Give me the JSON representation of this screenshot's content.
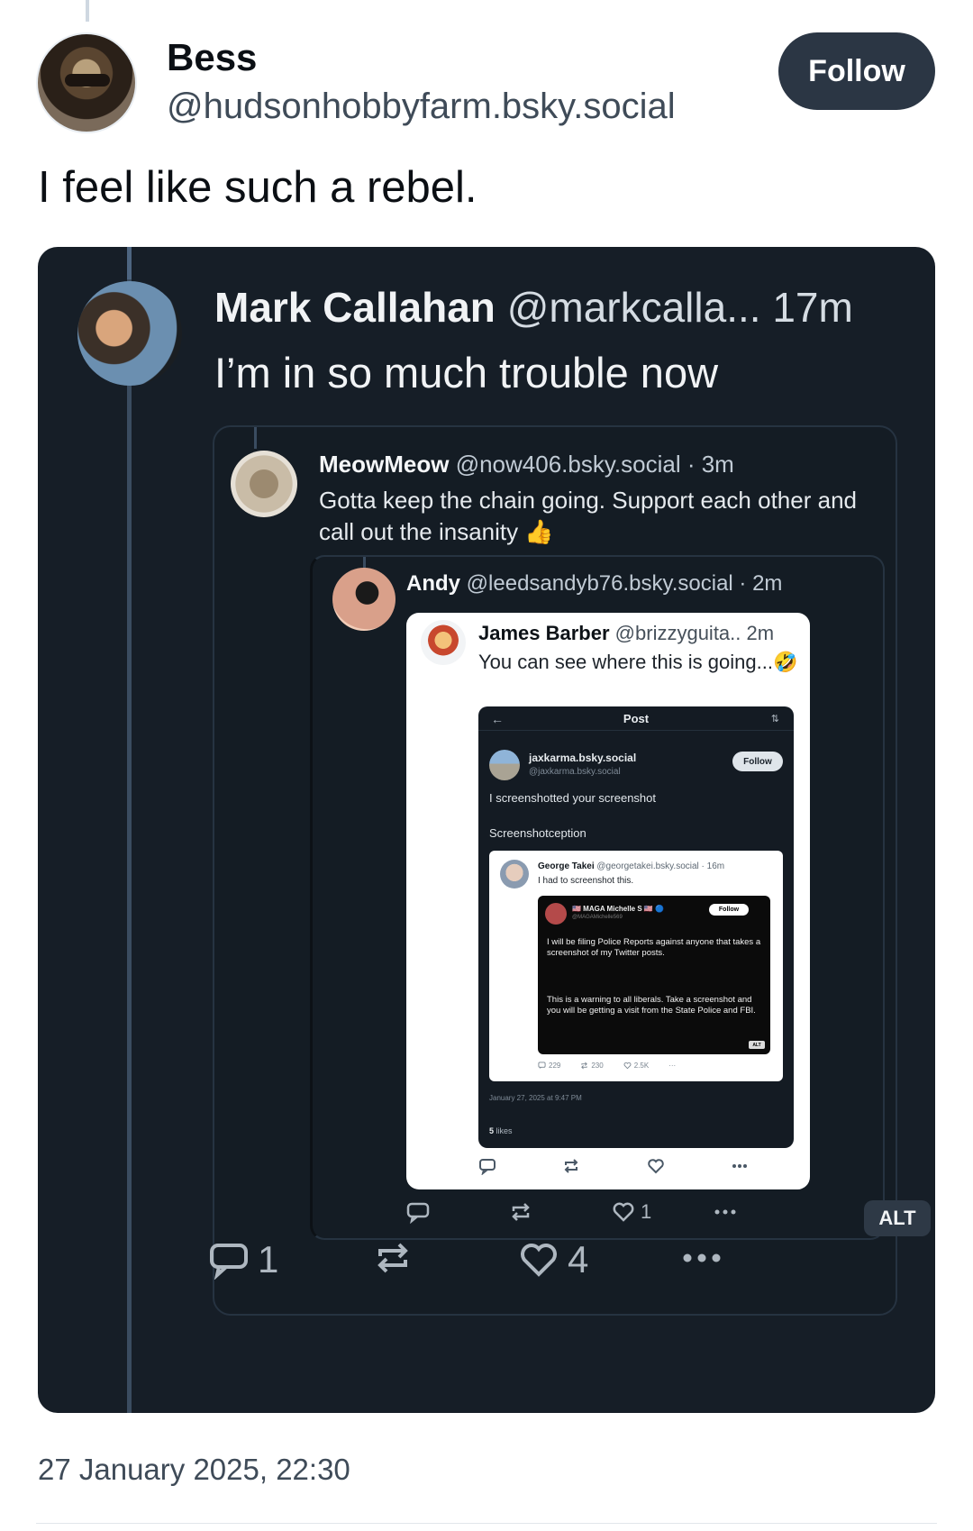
{
  "post": {
    "display_name": "Bess",
    "handle": "@hudsonhobbyfarm.bsky.social",
    "follow_label": "Follow",
    "text": "I feel like such a rebel.",
    "timestamp": "27 January 2025, 22:30"
  },
  "embed": {
    "author_name": "Mark Callahan",
    "author_meta": "@markcalla... 17m",
    "text": "I’m in so much trouble now",
    "replies": "1",
    "likes": "4",
    "quote1": {
      "name": "MeowMeow",
      "meta": "@now406.bsky.social · 3m",
      "text": "Gotta keep the chain going. Support each other and call out the insanity 👍",
      "quote2": {
        "name": "Andy",
        "meta": "@leedsandyb76.bsky.social · 2m",
        "likes": "1",
        "alt_label": "ALT",
        "card": {
          "name": "James Barber",
          "meta": "@brizzyguita.. 2m",
          "text": "You can see where this is going...🤣",
          "inner": {
            "back": "←",
            "title": "Post",
            "options": "⇅",
            "name": "jaxkarma.bsky.social",
            "handle": "@jaxkarma.bsky.social",
            "follow_label": "Follow",
            "text1": "I screenshotted your screenshot",
            "text2": "Screenshotception",
            "date": "January 27, 2025 at 9:47 PM",
            "likes_count": "5",
            "likes_word": "likes",
            "gt": {
              "name": "George Takei",
              "meta": "@georgetakei.bsky.social · 16m",
              "text": "I had to screenshot this.",
              "replies": "229",
              "reposts": "230",
              "likes": "2.5K",
              "more": "···",
              "maga": {
                "name": "🇺🇸 MAGA Michelle S 🇺🇸 🔵",
                "handle": "@MAGAMichelle569",
                "follow_label": "Follow",
                "text1": "I will be filing Police Reports against anyone that takes a screenshot of my Twitter posts.",
                "text2": "This is a warning to all liberals. Take a screenshot and you will be getting a visit from the State Police and FBI.",
                "alt_label": "ALT"
              }
            }
          }
        }
      }
    }
  },
  "icons": [
    "reply-icon",
    "repost-icon",
    "like-icon",
    "more-icon",
    "back-arrow-icon",
    "options-icon"
  ],
  "colors": {
    "follow_bg": "#2b3644",
    "card_bg": "#161e27",
    "thread_line": "#3a4c60"
  }
}
